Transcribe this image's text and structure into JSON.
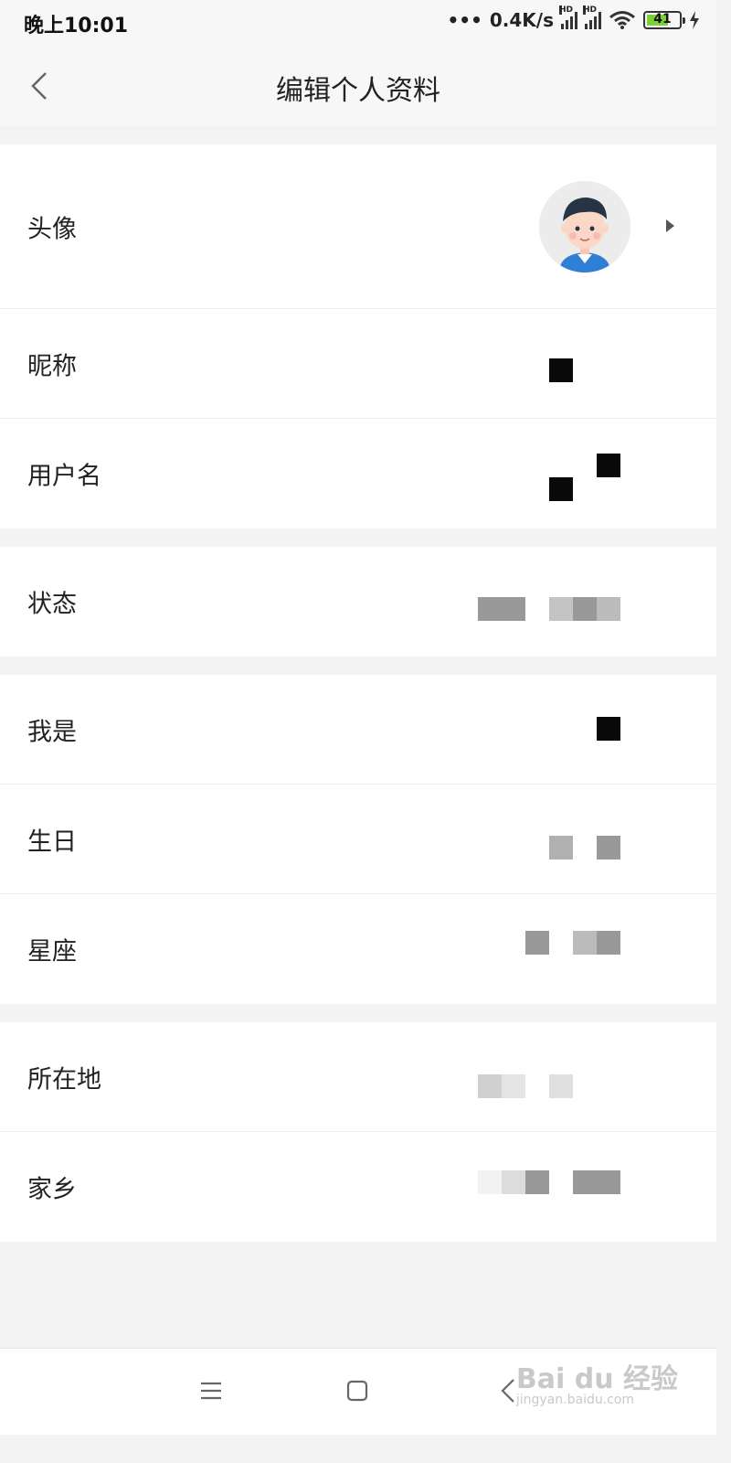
{
  "status_bar": {
    "time": "晚上10:01",
    "network_speed": "0.4K/s",
    "signal_1_label": "HD",
    "signal_2_label": "HD",
    "battery_level": "41"
  },
  "header": {
    "title": "编辑个人资料",
    "back_icon": "chevron-left-icon"
  },
  "profile_rows": [
    {
      "label": "头像"
    },
    {
      "label": "昵称"
    },
    {
      "label": "用户名"
    },
    {
      "label": "状态"
    },
    {
      "label": "我是"
    },
    {
      "label": "生日"
    },
    {
      "label": "星座"
    },
    {
      "label": "所在地"
    },
    {
      "label": "家乡"
    }
  ],
  "bottom_nav": {
    "menu_icon": "menu-icon",
    "home_icon": "home-square-icon",
    "back_icon": "back-chevron-icon"
  },
  "watermark": {
    "brand": "Bai du 经验",
    "url": "jingyan.baidu.com"
  },
  "colors": {
    "background": "#f3f3f3",
    "card": "#ffffff",
    "battery_fill": "#7ccf3b"
  }
}
